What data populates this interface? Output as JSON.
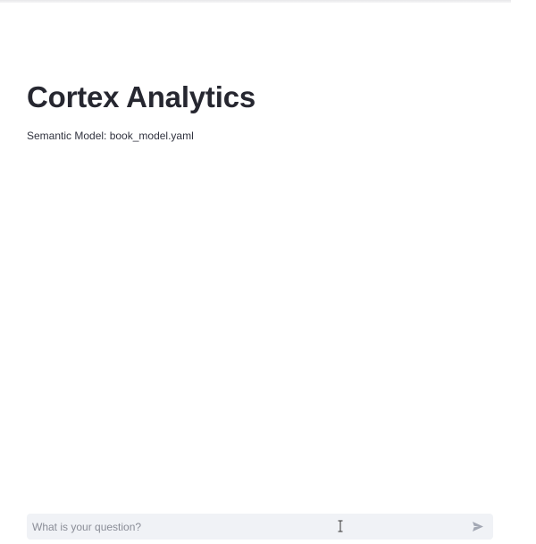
{
  "page": {
    "title": "Cortex Analytics",
    "semantic_model_text": "Semantic Model: book_model.yaml"
  },
  "chat": {
    "input_placeholder": "What is your question?",
    "input_value": ""
  },
  "icons": {
    "send": "send-icon",
    "cursor": "text-cursor-icon"
  },
  "colors": {
    "input_background": "#f0f2f6",
    "send_icon": "#a3a8b4"
  }
}
